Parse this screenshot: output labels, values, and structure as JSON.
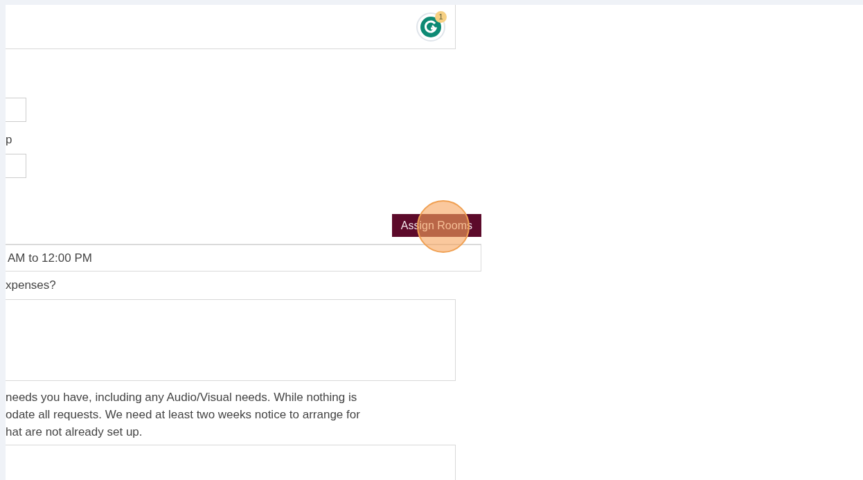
{
  "top_field": {
    "badge": {
      "count": "1"
    }
  },
  "label_1": "p",
  "assign_button": {
    "label": "Assign Rooms",
    "clicked": true
  },
  "time_field": {
    "value": "AM to 12:00 PM"
  },
  "expenses_label": "xpenses?",
  "needs_paragraph": [
    "needs you have, including any Audio/Visual needs. While nothing is",
    "odate all requests. We need at least two weeks notice to arrange for",
    "hat are not already set up."
  ]
}
